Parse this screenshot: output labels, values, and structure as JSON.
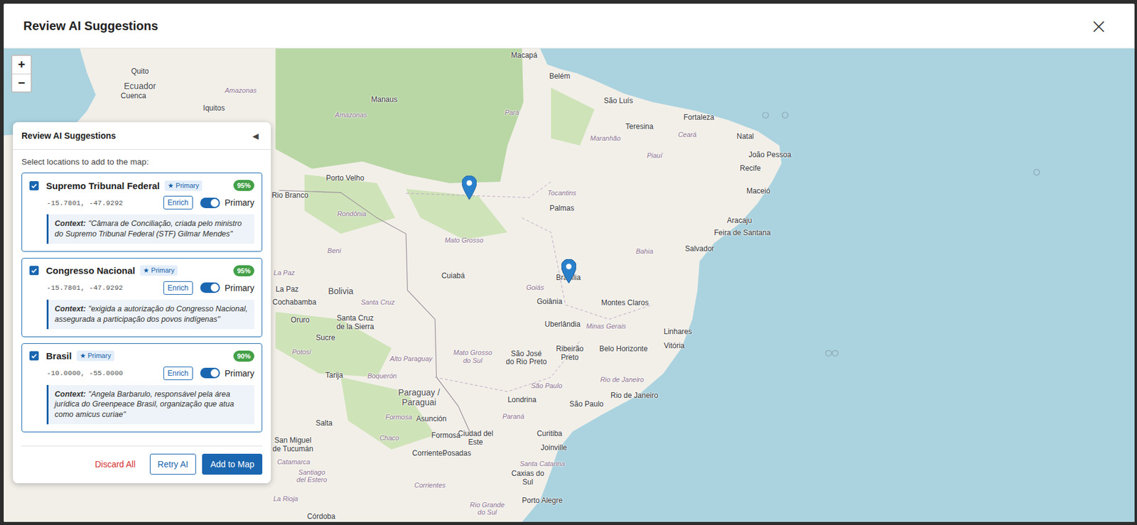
{
  "window": {
    "title": "Review AI Suggestions",
    "close": "×"
  },
  "map": {
    "zoom_in": "+",
    "zoom_out": "−",
    "labels": [
      {
        "text": "Quito",
        "kind": "city"
      },
      {
        "text": "Ecuador",
        "kind": "country"
      },
      {
        "text": "Cuenca",
        "kind": "city"
      },
      {
        "text": "Iquitos",
        "kind": "city"
      },
      {
        "text": "Amazonas",
        "kind": "region"
      },
      {
        "text": "Macapá",
        "kind": "city"
      },
      {
        "text": "Belém",
        "kind": "city"
      },
      {
        "text": "Manaus",
        "kind": "city"
      },
      {
        "text": "Amazonas",
        "kind": "region"
      },
      {
        "text": "Pará",
        "kind": "region"
      },
      {
        "text": "São Luís",
        "kind": "city"
      },
      {
        "text": "Fortaleza",
        "kind": "city"
      },
      {
        "text": "Teresina",
        "kind": "city"
      },
      {
        "text": "Ceará",
        "kind": "region"
      },
      {
        "text": "Maranhão",
        "kind": "region"
      },
      {
        "text": "Natal",
        "kind": "city"
      },
      {
        "text": "Piauí",
        "kind": "region"
      },
      {
        "text": "João Pessoa",
        "kind": "city"
      },
      {
        "text": "Recife",
        "kind": "city"
      },
      {
        "text": "Maceió",
        "kind": "city"
      },
      {
        "text": "Tocantins",
        "kind": "region"
      },
      {
        "text": "Palmas",
        "kind": "city"
      },
      {
        "text": "Porto Velho",
        "kind": "city"
      },
      {
        "text": "Rio Branco",
        "kind": "city"
      },
      {
        "text": "Rondônia",
        "kind": "region"
      },
      {
        "text": "Aracaju",
        "kind": "city"
      },
      {
        "text": "Feira de Santana",
        "kind": "city"
      },
      {
        "text": "Mato Grosso",
        "kind": "region"
      },
      {
        "text": "Salvador",
        "kind": "city"
      },
      {
        "text": "Beni",
        "kind": "region"
      },
      {
        "text": "Bahia",
        "kind": "region"
      },
      {
        "text": "La Paz",
        "kind": "region"
      },
      {
        "text": "La Paz",
        "kind": "city"
      },
      {
        "text": "Cuiabá",
        "kind": "city"
      },
      {
        "text": "Brasília",
        "kind": "city"
      },
      {
        "text": "Goiás",
        "kind": "region"
      },
      {
        "text": "Bolivia",
        "kind": "country"
      },
      {
        "text": "Cochabamba",
        "kind": "city"
      },
      {
        "text": "Santa Cruz",
        "kind": "region"
      },
      {
        "text": "Goiânia",
        "kind": "city"
      },
      {
        "text": "Montes Claros",
        "kind": "city"
      },
      {
        "text": "Oruro",
        "kind": "city"
      },
      {
        "text": "Santa Cruz\nde la Sierra",
        "kind": "city"
      },
      {
        "text": "Uberlândia",
        "kind": "city"
      },
      {
        "text": "Minas Gerais",
        "kind": "region"
      },
      {
        "text": "Linhares",
        "kind": "city"
      },
      {
        "text": "Sucre",
        "kind": "city"
      },
      {
        "text": "Vitória",
        "kind": "city"
      },
      {
        "text": "Belo Horizonte",
        "kind": "city"
      },
      {
        "text": "Potosí",
        "kind": "region"
      },
      {
        "text": "Mato Grosso\ndo Sul",
        "kind": "region"
      },
      {
        "text": "São José\ndo Rio Preto",
        "kind": "city"
      },
      {
        "text": "Ribeirão\nPreto",
        "kind": "city"
      },
      {
        "text": "Alto Paraguay",
        "kind": "region"
      },
      {
        "text": "Tarija",
        "kind": "city"
      },
      {
        "text": "Boquerón",
        "kind": "region"
      },
      {
        "text": "Rio de Janeiro",
        "kind": "region"
      },
      {
        "text": "São Paulo",
        "kind": "region"
      },
      {
        "text": "Paraguay /\nParaguai",
        "kind": "country"
      },
      {
        "text": "Rio de Janeiro",
        "kind": "city"
      },
      {
        "text": "Londrina",
        "kind": "city"
      },
      {
        "text": "São Paulo",
        "kind": "city"
      },
      {
        "text": "Paraná",
        "kind": "region"
      },
      {
        "text": "Formosa",
        "kind": "region"
      },
      {
        "text": "Asunción",
        "kind": "city"
      },
      {
        "text": "Salta",
        "kind": "city"
      },
      {
        "text": "Curitiba",
        "kind": "city"
      },
      {
        "text": "Ciudad del\nEste",
        "kind": "city"
      },
      {
        "text": "Formosa",
        "kind": "city"
      },
      {
        "text": "Chaco",
        "kind": "region"
      },
      {
        "text": "San Miguel\nde Tucumán",
        "kind": "city"
      },
      {
        "text": "Joinville",
        "kind": "city"
      },
      {
        "text": "Corrientes",
        "kind": "city"
      },
      {
        "text": "Posadas",
        "kind": "city"
      },
      {
        "text": "Catamarca",
        "kind": "region"
      },
      {
        "text": "Santa Catarina",
        "kind": "region"
      },
      {
        "text": "Caxias do\nSul",
        "kind": "city"
      },
      {
        "text": "Corrientes",
        "kind": "region"
      },
      {
        "text": "La Rioja",
        "kind": "region"
      },
      {
        "text": "Porto Alegre",
        "kind": "city"
      },
      {
        "text": "Rio Grande\ndo Sul",
        "kind": "region"
      },
      {
        "text": "Córdoba",
        "kind": "city"
      },
      {
        "text": "Santiago\ndel Estero",
        "kind": "region"
      }
    ]
  },
  "panel": {
    "title": "Review AI Suggestions",
    "collapse": "◀",
    "instruction": "Select locations to add to the map:"
  },
  "suggestions": [
    {
      "name": "Supremo Tribunal Federal",
      "badge": "★ Primary",
      "confidence": "95%",
      "coords": "-15.7801, -47.9292",
      "checked": true,
      "enrich": "Enrich",
      "primary_on": true,
      "toggle_label": "Primary",
      "context_label": "Context:",
      "context": "\"Câmara de Conciliação, criada pelo ministro do Supremo Tribunal Federal (STF) Gilmar Mendes\""
    },
    {
      "name": "Congresso Nacional",
      "badge": "★ Primary",
      "confidence": "95%",
      "coords": "-15.7801, -47.9292",
      "checked": true,
      "enrich": "Enrich",
      "primary_on": true,
      "toggle_label": "Primary",
      "context_label": "Context:",
      "context": "\"exigida a autorização do Congresso Nacional, assegurada a participação dos povos indígenas\""
    },
    {
      "name": "Brasil",
      "badge": "★ Primary",
      "confidence": "90%",
      "coords": "-10.0000, -55.0000",
      "checked": true,
      "enrich": "Enrich",
      "primary_on": true,
      "toggle_label": "Primary",
      "context_label": "Context:",
      "context": "\"Angela Barbarulo, responsável pela área jurídica do Greenpeace Brasil, organização que atua como amicus curiae\""
    }
  ],
  "actions": [
    {
      "label": "Discard All",
      "kind": "danger"
    },
    {
      "label": "Retry AI",
      "kind": "outline"
    },
    {
      "label": "Add to Map",
      "kind": "primary"
    }
  ]
}
